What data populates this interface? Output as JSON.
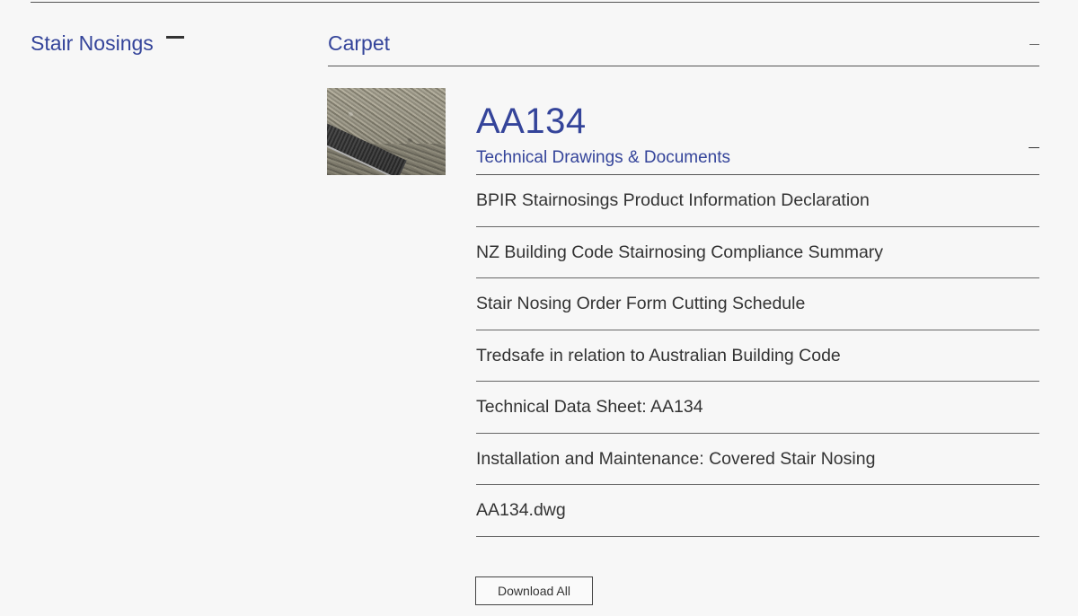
{
  "sidebar": {
    "category_title": "Stair Nosings",
    "collapse_icon": "minus-icon"
  },
  "section": {
    "title": "Carpet",
    "collapse_icon": "minus-icon"
  },
  "product": {
    "name": "AA134",
    "subtitle": "Technical Drawings & Documents",
    "collapse_icon": "minus-icon",
    "thumbnail_icon": "product-thumbnail-image"
  },
  "documents": [
    {
      "label": "BPIR Stairnosings Product Information Declaration"
    },
    {
      "label": "NZ Building Code Stairnosing Compliance Summary"
    },
    {
      "label": "Stair Nosing Order Form Cutting Schedule"
    },
    {
      "label": "Tredsafe in relation to Australian Building Code"
    },
    {
      "label": "Technical Data Sheet: AA134"
    },
    {
      "label": "Installation and Maintenance: Covered Stair Nosing"
    },
    {
      "label": "AA134.dwg"
    }
  ],
  "actions": {
    "download_all_label": "Download All"
  },
  "colors": {
    "accent": "#34449a",
    "text": "#333333",
    "background": "#f7f7f7"
  }
}
